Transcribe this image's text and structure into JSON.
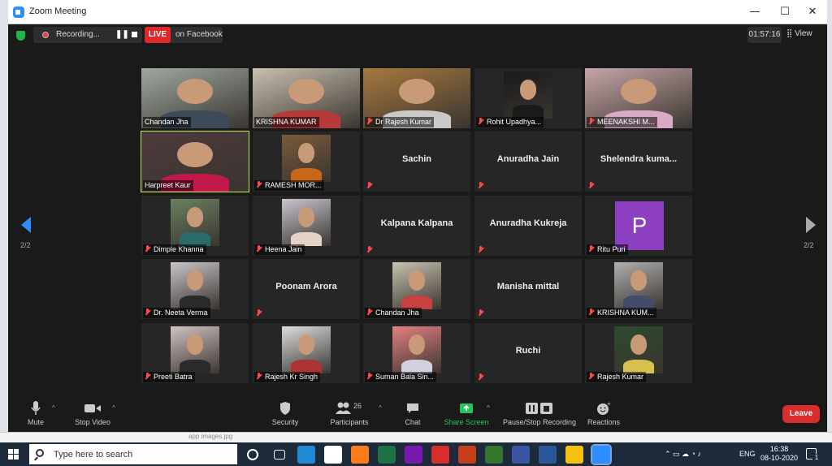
{
  "window": {
    "title": "Zoom Meeting",
    "controls": [
      "—",
      "☐",
      "✕"
    ]
  },
  "topbar": {
    "recording_label": "Recording...",
    "pause_symbol": "❚❚",
    "live_badge": "LIVE",
    "live_target": "on Facebook",
    "timer": "01:57:16",
    "view_label": "View"
  },
  "pager": {
    "left": "2/2",
    "right": "2/2"
  },
  "tiles": [
    {
      "name": "Chandan Jha",
      "muted": false,
      "kind": "video"
    },
    {
      "name": "KRISHNA KUMAR",
      "muted": false,
      "kind": "video"
    },
    {
      "name": "Dr Rajesh Kumar",
      "muted": true,
      "kind": "video"
    },
    {
      "name": "Rohit Upadhya...",
      "muted": true,
      "kind": "photo"
    },
    {
      "name": "MEENAKSHI M...",
      "muted": true,
      "kind": "video"
    },
    {
      "name": "Harpreet Kaur",
      "muted": false,
      "kind": "video",
      "active": true
    },
    {
      "name": "RAMESH MOR...",
      "muted": true,
      "kind": "photo"
    },
    {
      "name": "Sachin",
      "muted": true,
      "kind": "name"
    },
    {
      "name": "Anuradha Jain",
      "muted": true,
      "kind": "name"
    },
    {
      "name": "Shelendra  kuma...",
      "muted": true,
      "kind": "name"
    },
    {
      "name": "Dimple Khanna",
      "muted": true,
      "kind": "photo"
    },
    {
      "name": "Heena Jain",
      "muted": true,
      "kind": "photo"
    },
    {
      "name": "Kalpana Kalpana",
      "muted": true,
      "kind": "name"
    },
    {
      "name": "Anuradha Kukreja",
      "muted": true,
      "kind": "name"
    },
    {
      "name": "Ritu Puri",
      "muted": true,
      "kind": "avatar",
      "initial": "P"
    },
    {
      "name": "Dr. Neeta Verma",
      "muted": true,
      "kind": "photo"
    },
    {
      "name": "Poonam Arora",
      "muted": true,
      "kind": "name"
    },
    {
      "name": "Chandan Jha",
      "muted": true,
      "kind": "photo"
    },
    {
      "name": "Manisha  mittal",
      "muted": true,
      "kind": "name"
    },
    {
      "name": "KRISHNA KUM...",
      "muted": true,
      "kind": "photo"
    },
    {
      "name": "Preeti Batra",
      "muted": true,
      "kind": "photo"
    },
    {
      "name": "Rajesh Kr Singh",
      "muted": true,
      "kind": "photo"
    },
    {
      "name": "Suman Bala Sin...",
      "muted": true,
      "kind": "photo"
    },
    {
      "name": "Ruchi",
      "muted": true,
      "kind": "name"
    },
    {
      "name": "Rajesh Kumar",
      "muted": true,
      "kind": "photo"
    }
  ],
  "toolbar": {
    "mute": "Mute",
    "stop_video": "Stop Video",
    "security": "Security",
    "participants": "Participants",
    "participants_count": "26",
    "chat": "Chat",
    "share_screen": "Share Screen",
    "record": "Pause/Stop Recording",
    "reactions": "Reactions",
    "leave": "Leave"
  },
  "taskbar": {
    "search_placeholder": "Type here to search",
    "language": "ENG",
    "time": "16:38",
    "date": "08-10-2020",
    "notification_count": "1",
    "apps": [
      {
        "name": "cortana-icon",
        "color": "#1c2a3a"
      },
      {
        "name": "task-view-icon",
        "color": "#1c2a3a"
      },
      {
        "name": "edge-icon",
        "color": "#1f8ad2"
      },
      {
        "name": "store-icon",
        "color": "#ffffff"
      },
      {
        "name": "firefox-icon",
        "color": "#ff7a1a"
      },
      {
        "name": "excel-icon",
        "color": "#1e7145"
      },
      {
        "name": "onenote-icon",
        "color": "#7719aa"
      },
      {
        "name": "photos-icon",
        "color": "#d92d2d"
      },
      {
        "name": "powerpoint-icon",
        "color": "#c43e1c"
      },
      {
        "name": "project-icon",
        "color": "#31752f"
      },
      {
        "name": "visio-icon",
        "color": "#3955a3"
      },
      {
        "name": "word-icon",
        "color": "#2b579a"
      },
      {
        "name": "chrome-icon",
        "color": "#f4c20d"
      },
      {
        "name": "zoom-icon",
        "color": "#2d8cff"
      }
    ]
  },
  "background_text": "app images.jpg"
}
